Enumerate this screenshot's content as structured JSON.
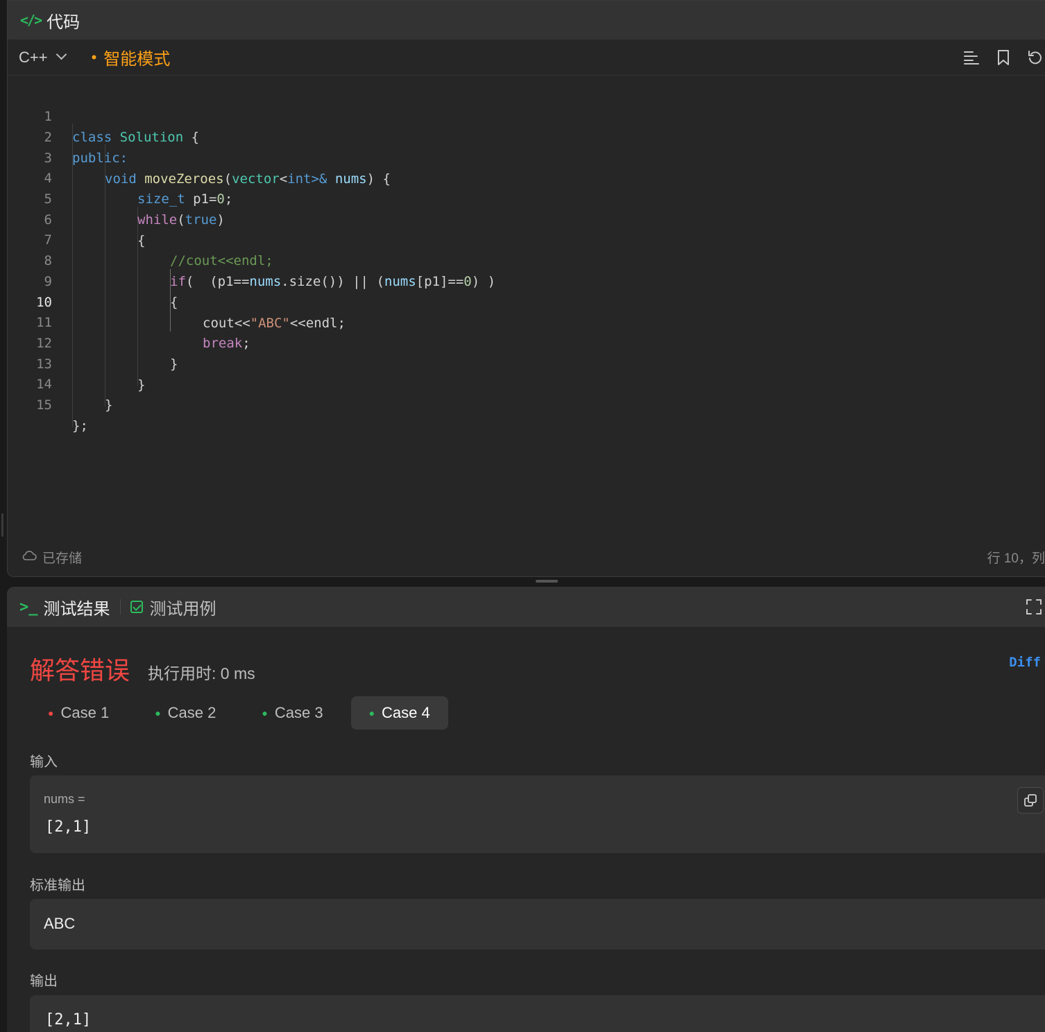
{
  "editor": {
    "title": "代码",
    "language": "C++",
    "mode_label": "智能模式",
    "toolbar_icons": [
      "format-icon",
      "bookmark-icon",
      "reset-icon"
    ],
    "saved_status": "已存储",
    "cursor_position": "行 10，列",
    "lines": [
      {
        "n": "1",
        "indent": 0
      },
      {
        "n": "2",
        "indent": 0
      },
      {
        "n": "3",
        "indent": 1
      },
      {
        "n": "4",
        "indent": 2
      },
      {
        "n": "5",
        "indent": 2
      },
      {
        "n": "6",
        "indent": 2
      },
      {
        "n": "7",
        "indent": 3
      },
      {
        "n": "8",
        "indent": 3
      },
      {
        "n": "9",
        "indent": 3
      },
      {
        "n": "10",
        "indent": 4,
        "active": true
      },
      {
        "n": "11",
        "indent": 4
      },
      {
        "n": "12",
        "indent": 3
      },
      {
        "n": "13",
        "indent": 2
      },
      {
        "n": "14",
        "indent": 1
      },
      {
        "n": "15",
        "indent": 0
      }
    ],
    "tokens": {
      "l1": [
        "class",
        " ",
        "Solution",
        " {"
      ],
      "l2": [
        "public:"
      ],
      "l3": [
        "void",
        " ",
        "moveZeroes",
        "(",
        "vector",
        "<",
        "int",
        ">& ",
        "nums",
        ") {"
      ],
      "l4": [
        "size_t",
        " p1=",
        "0",
        ";"
      ],
      "l5": [
        "while",
        "(",
        "true",
        ")"
      ],
      "l6": [
        "{"
      ],
      "l7": [
        "//cout<<endl;"
      ],
      "l8": [
        "if",
        "(  (p1==",
        "nums",
        ".size()) || (",
        "nums",
        "[p1]==",
        "0",
        ") )"
      ],
      "l9": [
        "{"
      ],
      "l10": [
        "cout<<",
        "\"ABC\"",
        "<<endl;"
      ],
      "l11": [
        "break",
        ";"
      ],
      "l12": [
        "}"
      ],
      "l13": [
        "}"
      ],
      "l14": [
        "}"
      ],
      "l15": [
        "};"
      ]
    }
  },
  "results": {
    "tab_result": "测试结果",
    "tab_testcase": "测试用例",
    "verdict": "解答错误",
    "runtime": "执行用时: 0 ms",
    "diff_label": "Diff",
    "colors": {
      "wrong": "#ef4743",
      "pass": "#2cbb5d",
      "accent": "#ffa116",
      "link": "#3b8ff0"
    },
    "cases": [
      {
        "label": "Case 1",
        "status": "fail",
        "active": false
      },
      {
        "label": "Case 2",
        "status": "pass",
        "active": false
      },
      {
        "label": "Case 3",
        "status": "pass",
        "active": false
      },
      {
        "label": "Case 4",
        "status": "pass",
        "active": true
      }
    ],
    "input_label": "输入",
    "input_var": "nums =",
    "input_value": "[2,1]",
    "stdout_label": "标准输出",
    "stdout_value": "ABC",
    "output_label": "输出",
    "output_value": "[2,1]"
  }
}
